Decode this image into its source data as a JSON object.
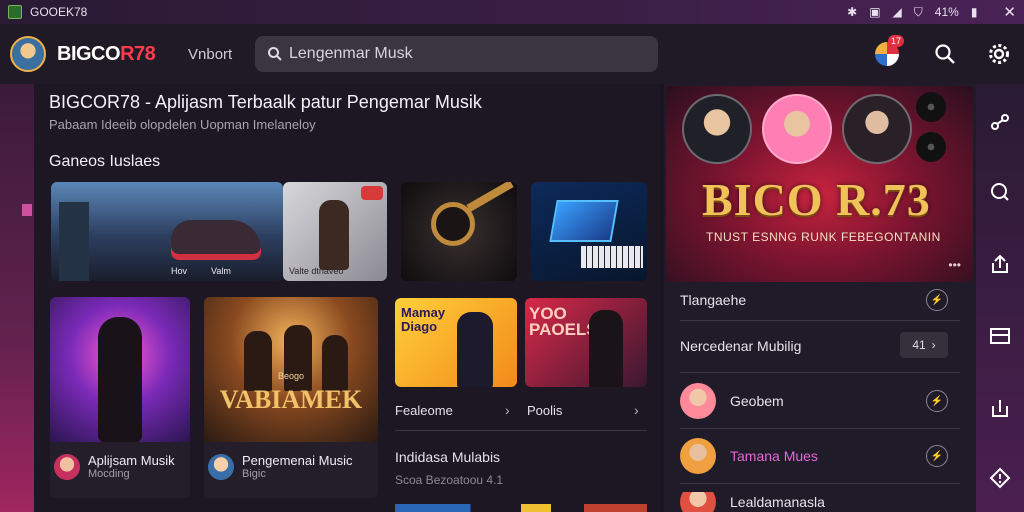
{
  "status_bar": {
    "title": "GOOEK78",
    "battery_text": "41%"
  },
  "header": {
    "brand_prefix": "BIGCO",
    "brand_accent": "R78",
    "nav_link": "Vnbort",
    "search_value": "Lengenmar Musk",
    "notification_count": "17"
  },
  "main": {
    "title": "BIGCOR78 - Aplijasm Terbaalk patur Pengemar Musik",
    "subtitle": "Pabaam Ideeib olopdelen Uopman Imelaneloy",
    "section_title": "Ganeos Iuslaes",
    "row1_captions": [
      "Hov",
      "Valm",
      "Valte dtnaveo"
    ],
    "row2": {
      "card_a_user": "Aplijsam Musik",
      "card_a_meta": "Mocding",
      "card_b_user": "Pengemenai Music",
      "card_b_meta": "Bigic",
      "poster_title": "VABIAMEK",
      "poster_top": "Beogo",
      "tile_a_overlay": "Mamay Diago",
      "tile_b_overlay": "YOO PAOELS",
      "tile_a_label": "Fealeome",
      "tile_b_label": "Poolis",
      "list_title": "Indidasa Mulabis",
      "list_sub": "Scoa Bezoatoou 4.1"
    }
  },
  "right_panel": {
    "hero_title": "BICO R.73",
    "hero_sub": "TNUST ESNNG RUNK FEBEGONTANIN",
    "rows": [
      {
        "label": "Tlangaehe"
      },
      {
        "label": "Nercedenar Mubilig",
        "chip": "41"
      },
      {
        "label": "Geobem"
      },
      {
        "label": "Tamana Mues"
      },
      {
        "label": "Lealdamanasla"
      }
    ]
  },
  "colors": {
    "accent_red": "#ff3b4c",
    "gold": "#f2c25a",
    "panel_bg": "#201b28",
    "highlight_pink": "#e468d6"
  }
}
